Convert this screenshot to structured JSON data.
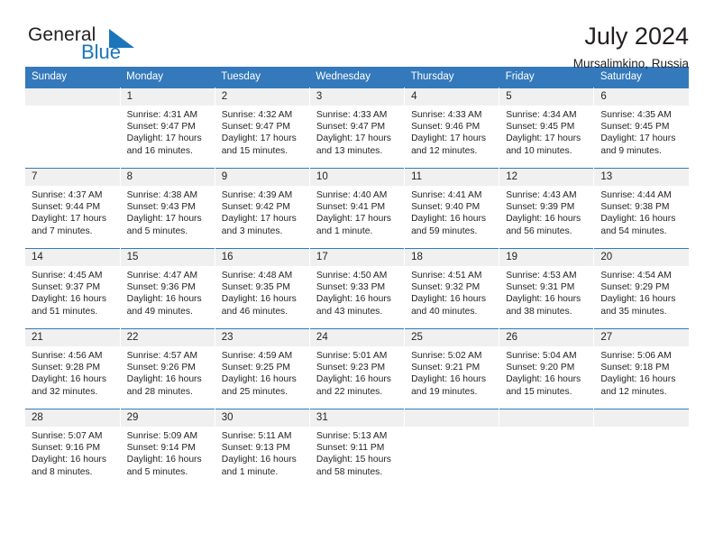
{
  "brand": {
    "word_one": "General",
    "word_two": "Blue",
    "triangle_color": "#1b75bb",
    "accent_color": "#3479bb"
  },
  "header": {
    "title": "July 2024",
    "subtitle": "Mursalimkino, Russia"
  },
  "calendar": {
    "weekday_headers": [
      "Sunday",
      "Monday",
      "Tuesday",
      "Wednesday",
      "Thursday",
      "Friday",
      "Saturday"
    ],
    "weeks": [
      [
        {
          "day": "",
          "lines": []
        },
        {
          "day": "1",
          "lines": [
            "Sunrise: 4:31 AM",
            "Sunset: 9:47 PM",
            "Daylight: 17 hours",
            "and 16 minutes."
          ]
        },
        {
          "day": "2",
          "lines": [
            "Sunrise: 4:32 AM",
            "Sunset: 9:47 PM",
            "Daylight: 17 hours",
            "and 15 minutes."
          ]
        },
        {
          "day": "3",
          "lines": [
            "Sunrise: 4:33 AM",
            "Sunset: 9:47 PM",
            "Daylight: 17 hours",
            "and 13 minutes."
          ]
        },
        {
          "day": "4",
          "lines": [
            "Sunrise: 4:33 AM",
            "Sunset: 9:46 PM",
            "Daylight: 17 hours",
            "and 12 minutes."
          ]
        },
        {
          "day": "5",
          "lines": [
            "Sunrise: 4:34 AM",
            "Sunset: 9:45 PM",
            "Daylight: 17 hours",
            "and 10 minutes."
          ]
        },
        {
          "day": "6",
          "lines": [
            "Sunrise: 4:35 AM",
            "Sunset: 9:45 PM",
            "Daylight: 17 hours",
            "and 9 minutes."
          ]
        }
      ],
      [
        {
          "day": "7",
          "lines": [
            "Sunrise: 4:37 AM",
            "Sunset: 9:44 PM",
            "Daylight: 17 hours",
            "and 7 minutes."
          ]
        },
        {
          "day": "8",
          "lines": [
            "Sunrise: 4:38 AM",
            "Sunset: 9:43 PM",
            "Daylight: 17 hours",
            "and 5 minutes."
          ]
        },
        {
          "day": "9",
          "lines": [
            "Sunrise: 4:39 AM",
            "Sunset: 9:42 PM",
            "Daylight: 17 hours",
            "and 3 minutes."
          ]
        },
        {
          "day": "10",
          "lines": [
            "Sunrise: 4:40 AM",
            "Sunset: 9:41 PM",
            "Daylight: 17 hours",
            "and 1 minute."
          ]
        },
        {
          "day": "11",
          "lines": [
            "Sunrise: 4:41 AM",
            "Sunset: 9:40 PM",
            "Daylight: 16 hours",
            "and 59 minutes."
          ]
        },
        {
          "day": "12",
          "lines": [
            "Sunrise: 4:43 AM",
            "Sunset: 9:39 PM",
            "Daylight: 16 hours",
            "and 56 minutes."
          ]
        },
        {
          "day": "13",
          "lines": [
            "Sunrise: 4:44 AM",
            "Sunset: 9:38 PM",
            "Daylight: 16 hours",
            "and 54 minutes."
          ]
        }
      ],
      [
        {
          "day": "14",
          "lines": [
            "Sunrise: 4:45 AM",
            "Sunset: 9:37 PM",
            "Daylight: 16 hours",
            "and 51 minutes."
          ]
        },
        {
          "day": "15",
          "lines": [
            "Sunrise: 4:47 AM",
            "Sunset: 9:36 PM",
            "Daylight: 16 hours",
            "and 49 minutes."
          ]
        },
        {
          "day": "16",
          "lines": [
            "Sunrise: 4:48 AM",
            "Sunset: 9:35 PM",
            "Daylight: 16 hours",
            "and 46 minutes."
          ]
        },
        {
          "day": "17",
          "lines": [
            "Sunrise: 4:50 AM",
            "Sunset: 9:33 PM",
            "Daylight: 16 hours",
            "and 43 minutes."
          ]
        },
        {
          "day": "18",
          "lines": [
            "Sunrise: 4:51 AM",
            "Sunset: 9:32 PM",
            "Daylight: 16 hours",
            "and 40 minutes."
          ]
        },
        {
          "day": "19",
          "lines": [
            "Sunrise: 4:53 AM",
            "Sunset: 9:31 PM",
            "Daylight: 16 hours",
            "and 38 minutes."
          ]
        },
        {
          "day": "20",
          "lines": [
            "Sunrise: 4:54 AM",
            "Sunset: 9:29 PM",
            "Daylight: 16 hours",
            "and 35 minutes."
          ]
        }
      ],
      [
        {
          "day": "21",
          "lines": [
            "Sunrise: 4:56 AM",
            "Sunset: 9:28 PM",
            "Daylight: 16 hours",
            "and 32 minutes."
          ]
        },
        {
          "day": "22",
          "lines": [
            "Sunrise: 4:57 AM",
            "Sunset: 9:26 PM",
            "Daylight: 16 hours",
            "and 28 minutes."
          ]
        },
        {
          "day": "23",
          "lines": [
            "Sunrise: 4:59 AM",
            "Sunset: 9:25 PM",
            "Daylight: 16 hours",
            "and 25 minutes."
          ]
        },
        {
          "day": "24",
          "lines": [
            "Sunrise: 5:01 AM",
            "Sunset: 9:23 PM",
            "Daylight: 16 hours",
            "and 22 minutes."
          ]
        },
        {
          "day": "25",
          "lines": [
            "Sunrise: 5:02 AM",
            "Sunset: 9:21 PM",
            "Daylight: 16 hours",
            "and 19 minutes."
          ]
        },
        {
          "day": "26",
          "lines": [
            "Sunrise: 5:04 AM",
            "Sunset: 9:20 PM",
            "Daylight: 16 hours",
            "and 15 minutes."
          ]
        },
        {
          "day": "27",
          "lines": [
            "Sunrise: 5:06 AM",
            "Sunset: 9:18 PM",
            "Daylight: 16 hours",
            "and 12 minutes."
          ]
        }
      ],
      [
        {
          "day": "28",
          "lines": [
            "Sunrise: 5:07 AM",
            "Sunset: 9:16 PM",
            "Daylight: 16 hours",
            "and 8 minutes."
          ]
        },
        {
          "day": "29",
          "lines": [
            "Sunrise: 5:09 AM",
            "Sunset: 9:14 PM",
            "Daylight: 16 hours",
            "and 5 minutes."
          ]
        },
        {
          "day": "30",
          "lines": [
            "Sunrise: 5:11 AM",
            "Sunset: 9:13 PM",
            "Daylight: 16 hours",
            "and 1 minute."
          ]
        },
        {
          "day": "31",
          "lines": [
            "Sunrise: 5:13 AM",
            "Sunset: 9:11 PM",
            "Daylight: 15 hours",
            "and 58 minutes."
          ]
        },
        {
          "day": "",
          "lines": []
        },
        {
          "day": "",
          "lines": []
        },
        {
          "day": "",
          "lines": []
        }
      ]
    ]
  }
}
